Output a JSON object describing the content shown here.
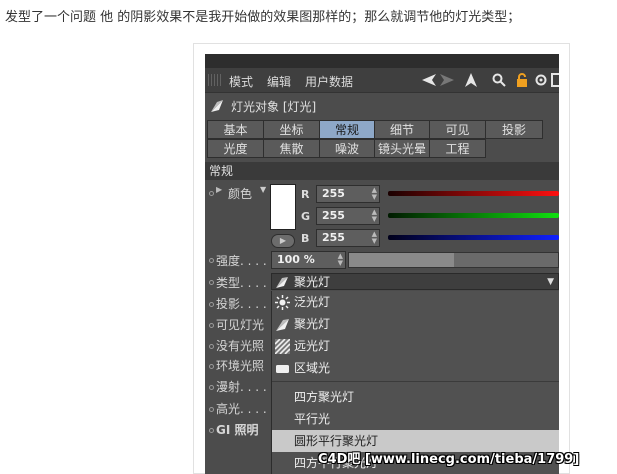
{
  "caption": "发型了一个问题  他 的阴影效果不是我开始做的效果图那样的；那么就调节他的灯光类型；",
  "menu": {
    "items": [
      "模式",
      "编辑",
      "用户数据"
    ]
  },
  "object_title": "灯光对象 [灯光]",
  "tabs_row1": [
    "基本",
    "坐标",
    "常规",
    "细节",
    "可见",
    "投影"
  ],
  "tabs_row2": [
    "光度",
    "焦散",
    "噪波",
    "镜头光晕",
    "工程"
  ],
  "active_tab": "常规",
  "section_title": "常规",
  "color": {
    "label": "颜色",
    "swatch": "#ffffff",
    "channels": [
      {
        "name": "R",
        "value": "255",
        "color": "#ff2020"
      },
      {
        "name": "G",
        "value": "255",
        "color": "#20e020"
      },
      {
        "name": "B",
        "value": "255",
        "color": "#2030ff"
      }
    ]
  },
  "labels": {
    "intensity": "强度. . . .",
    "type": "类型. . . .",
    "shadow": "投影. . . .",
    "visible_light": "可见灯光",
    "no_light": "没有光照",
    "ambient": "环境光照",
    "diffuse": "漫射. . . .",
    "specular": "高光. . . .",
    "gi": "GI 照明"
  },
  "intensity": {
    "value": "100 %",
    "fill_percent": 0.5
  },
  "type_select": {
    "value": "聚光灯"
  },
  "dropdown_items": [
    {
      "label": "泛光灯",
      "icon": "omni-light-icon"
    },
    {
      "label": "聚光灯",
      "icon": "spot-light-icon"
    },
    {
      "label": "远光灯",
      "icon": "infinite-light-icon"
    },
    {
      "label": "区域光",
      "icon": "area-light-icon"
    },
    {
      "label": "四方聚光灯",
      "icon": ""
    },
    {
      "label": "平行光",
      "icon": ""
    },
    {
      "label": "圆形平行聚光灯",
      "icon": "",
      "highlighted": true
    },
    {
      "label": "四方平行聚光灯",
      "icon": ""
    }
  ],
  "watermark": "C4D吧  [www.linecg.com/tieba/1799]"
}
